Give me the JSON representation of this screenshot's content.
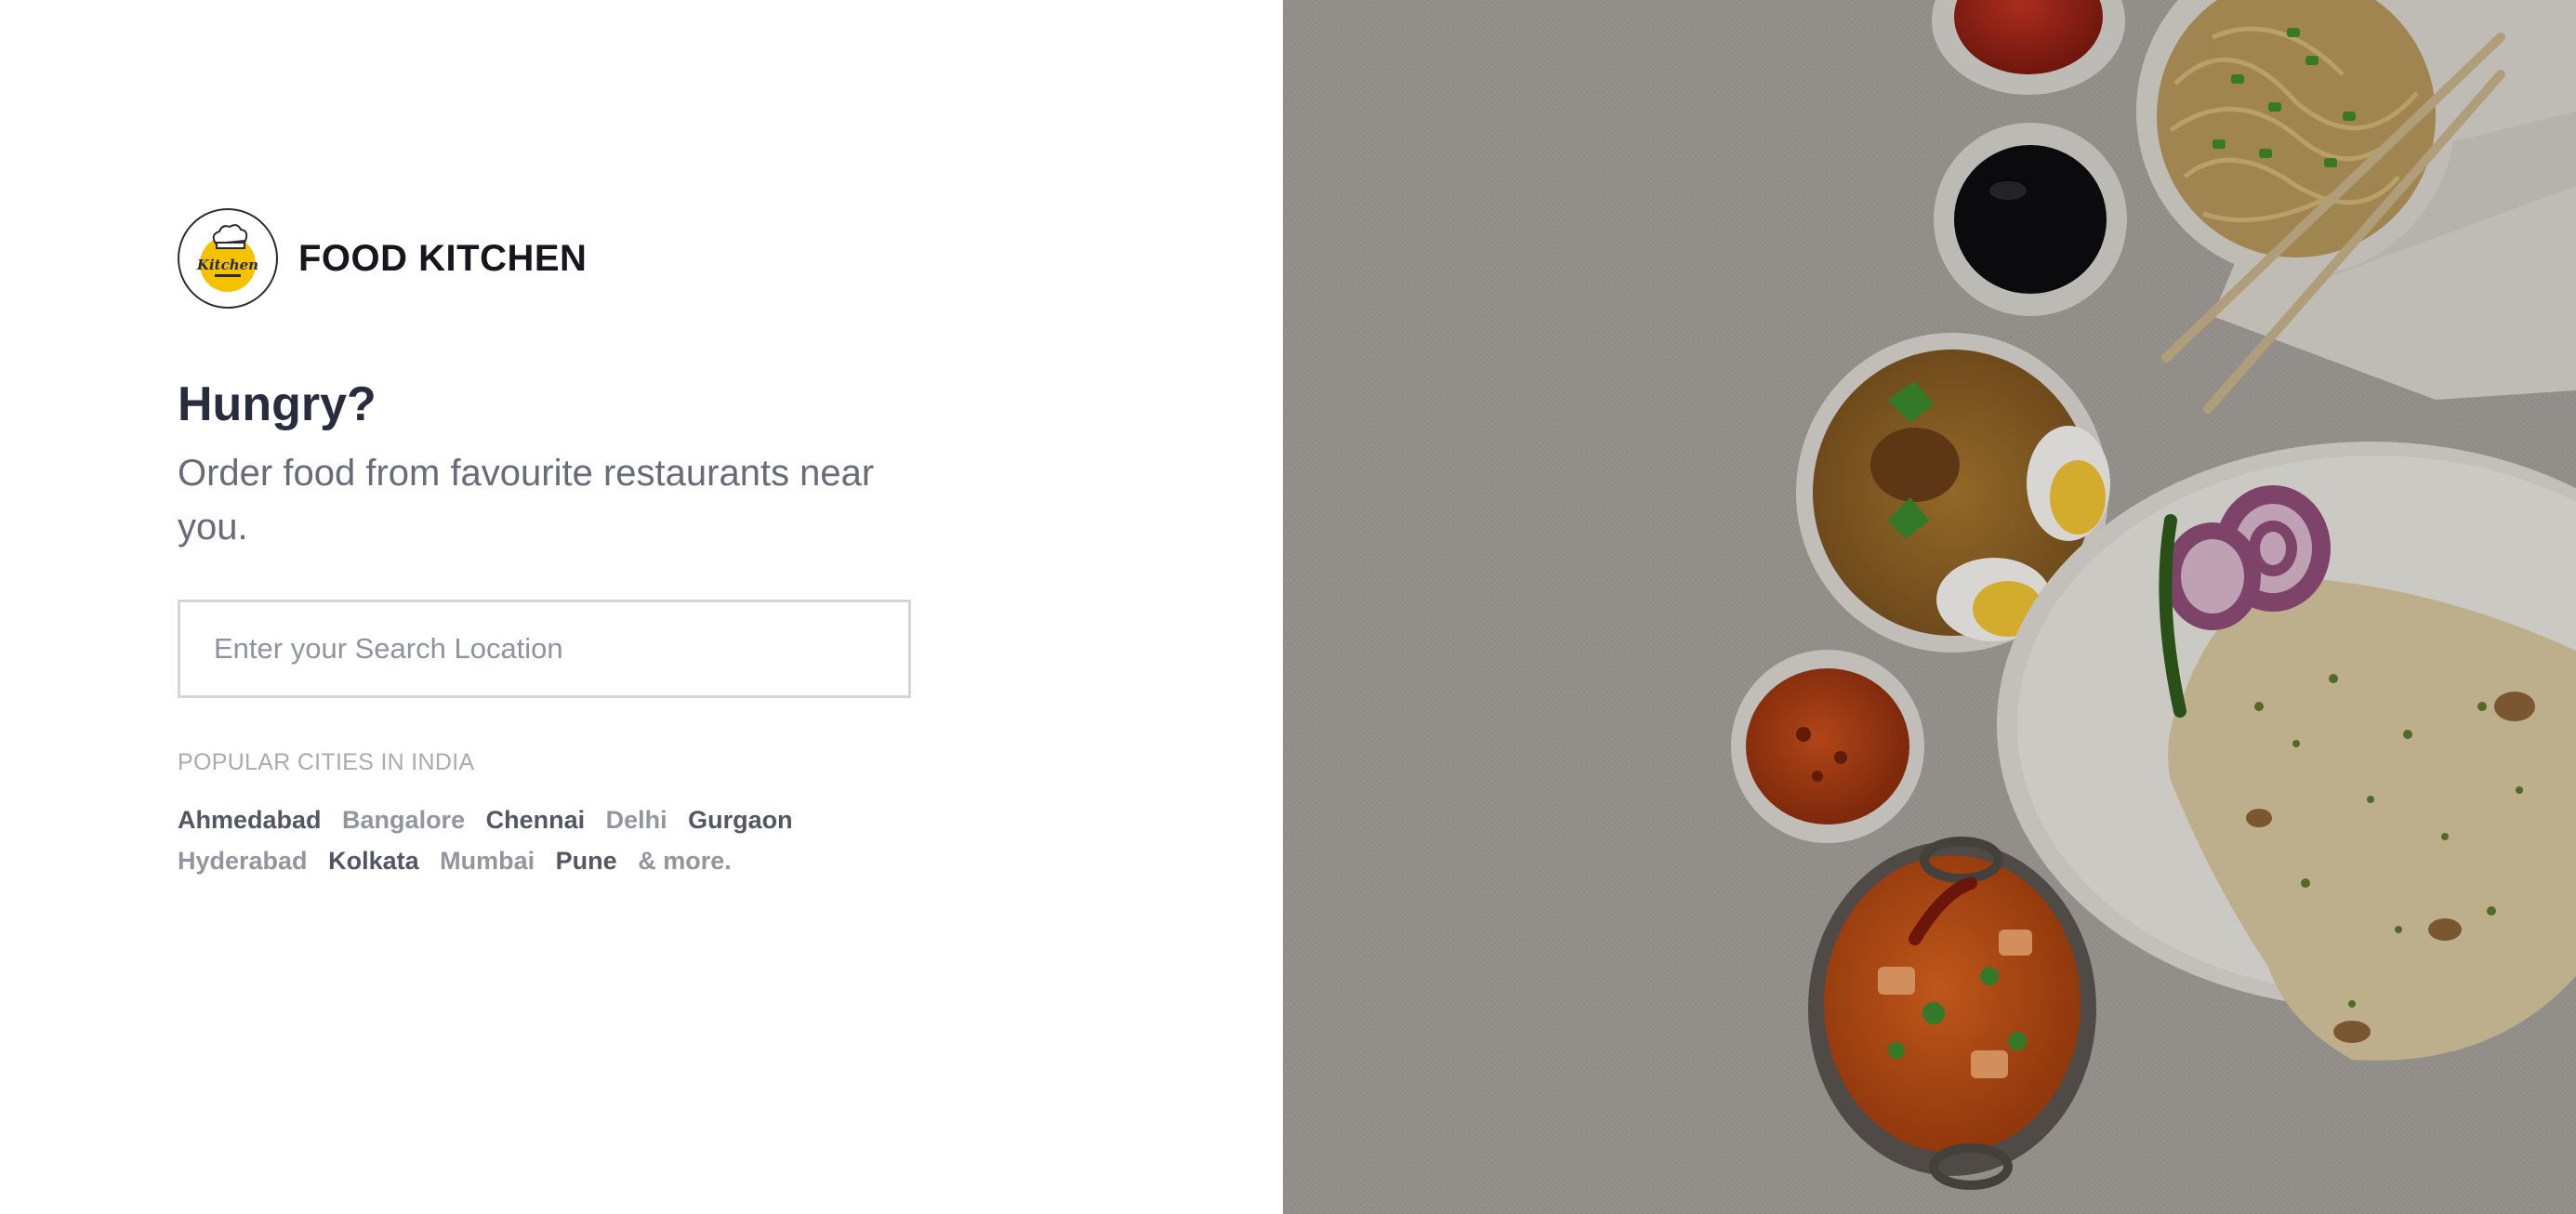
{
  "brand": {
    "name": "FOOD KITCHEN",
    "logo_icon": "chef-hat-kitchen-logo-icon",
    "logo_text": "Kitchen"
  },
  "hero": {
    "headline": "Hungry?",
    "subline": "Order food from favourite restaurants near you."
  },
  "search": {
    "placeholder": "Enter your Search Location",
    "value": ""
  },
  "popular": {
    "label": "POPULAR CITIES IN INDIA",
    "cities": [
      {
        "name": "Ahmedabad",
        "tone": "dark"
      },
      {
        "name": "Bangalore",
        "tone": "light"
      },
      {
        "name": "Chennai",
        "tone": "dark"
      },
      {
        "name": "Delhi",
        "tone": "light"
      },
      {
        "name": "Gurgaon",
        "tone": "dark"
      },
      {
        "name": "Hyderabad",
        "tone": "light"
      },
      {
        "name": "Kolkata",
        "tone": "dark"
      },
      {
        "name": "Mumbai",
        "tone": "light"
      },
      {
        "name": "Pune",
        "tone": "dark"
      }
    ],
    "more_label": "& more."
  },
  "colors": {
    "heading": "#282c3f",
    "subtext": "#686b78",
    "city_dark": "#535665",
    "city_light": "#93959f",
    "logo_yellow": "#f5c200"
  },
  "hero_image": {
    "description_icon": "food-spread-image"
  }
}
